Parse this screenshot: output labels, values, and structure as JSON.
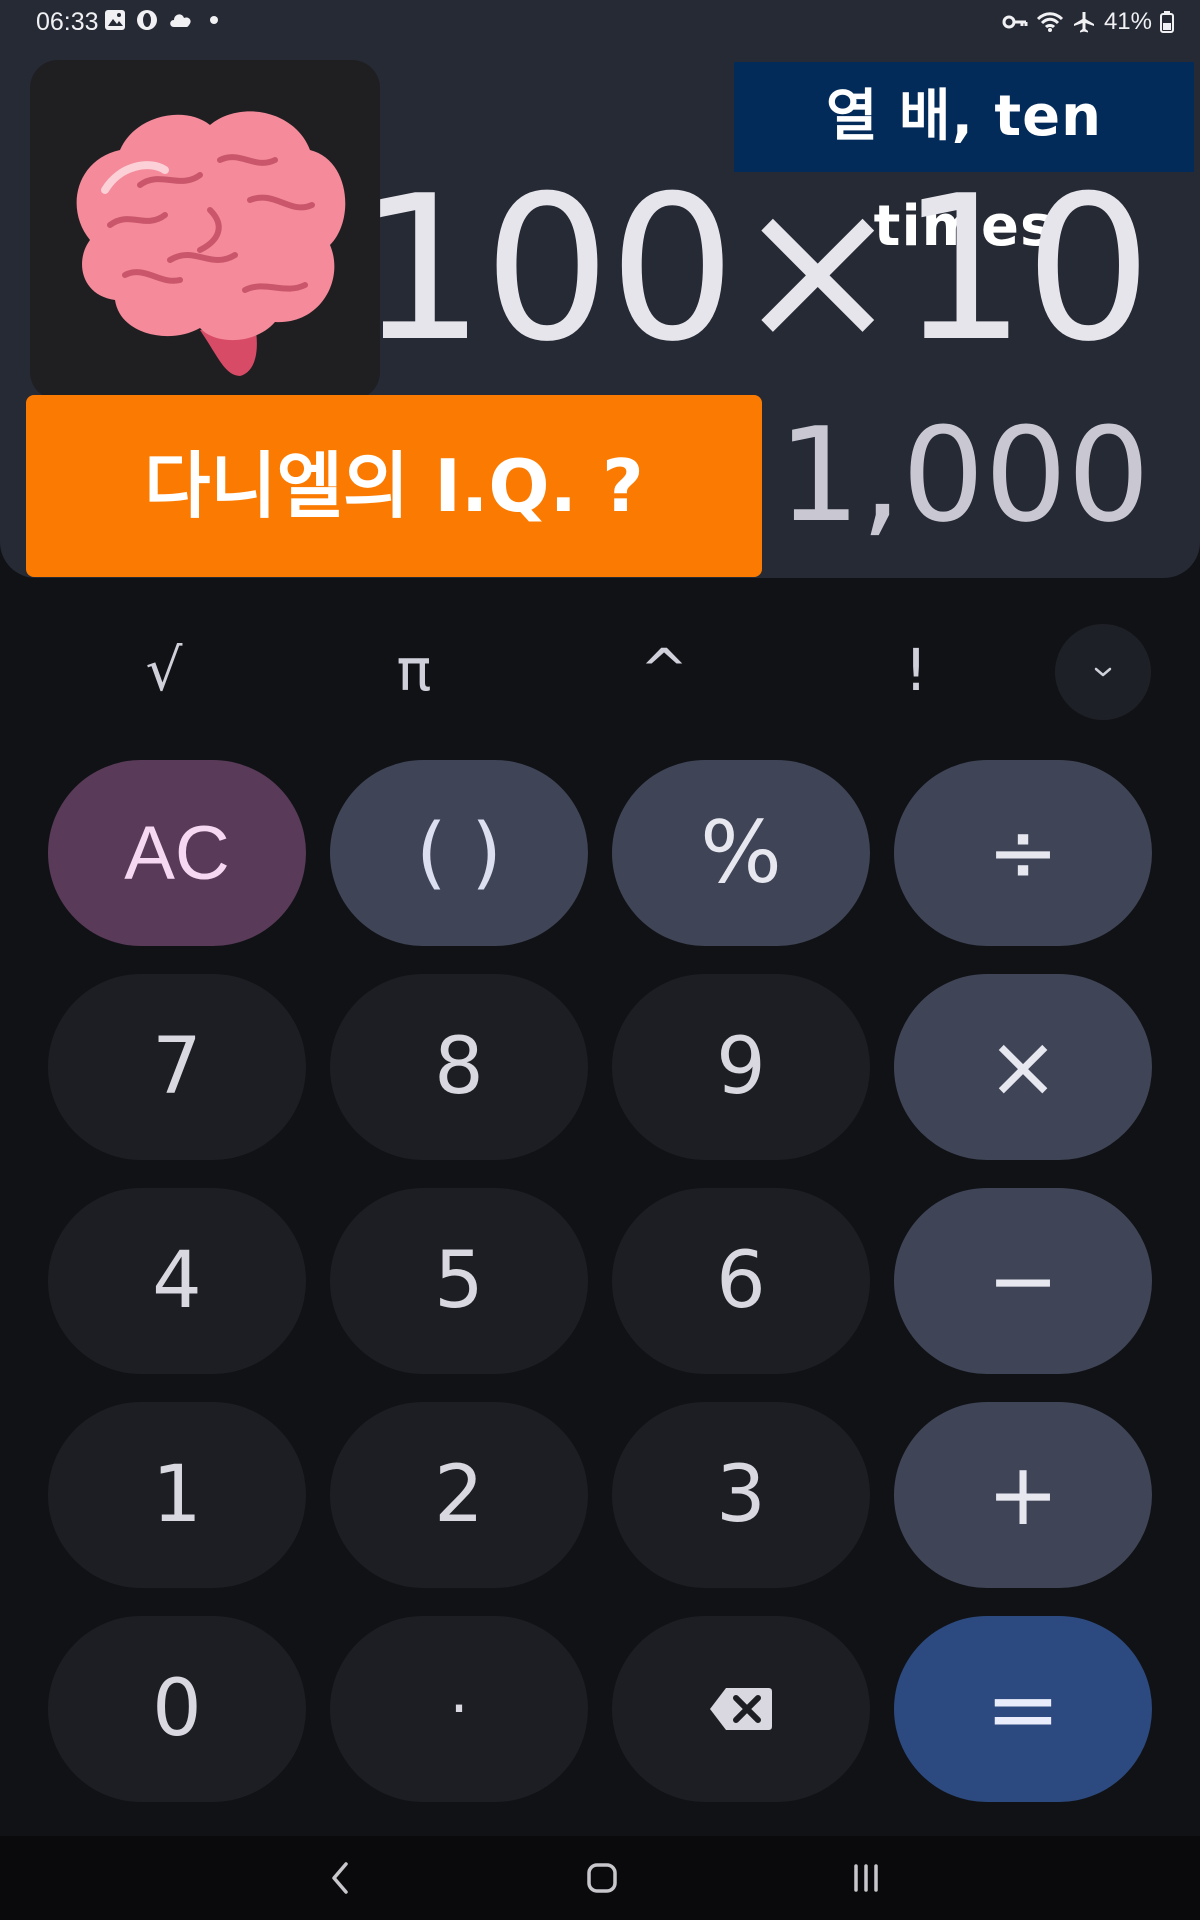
{
  "status_bar": {
    "time": "06:33",
    "battery": "41%"
  },
  "display": {
    "caption_en": "열 배, ten times",
    "expression": "100×10",
    "result": "1,000",
    "caption_ko": "다니엘의 I.Q. ?"
  },
  "scientific_keys": [
    "√",
    "π",
    "^",
    "!"
  ],
  "keypad": {
    "ac": "AC",
    "parentheses": "( )",
    "percent": "%",
    "divide": "÷",
    "seven": "7",
    "eight": "8",
    "nine": "9",
    "multiply": "×",
    "four": "4",
    "five": "5",
    "six": "6",
    "minus": "−",
    "one": "1",
    "two": "2",
    "three": "3",
    "plus": "+",
    "zero": "0",
    "decimal": "·",
    "equals": "="
  },
  "colors": {
    "display_bg": "#262a35",
    "keypad_bg": "#111216",
    "operator_key": "#3f4557",
    "ac_key": "#593a58",
    "equals_key": "#2c4a7f",
    "caption_ko_bg": "#fb7b02",
    "caption_en_bg": "#032b5a"
  },
  "icons": {
    "status_left": [
      "gallery-icon",
      "opera-icon",
      "cloud-icon",
      "notification-dot-icon"
    ],
    "status_right": [
      "key-icon",
      "wifi-icon",
      "airplane-icon",
      "battery-icon"
    ],
    "brain": "brain-emoji-icon",
    "expand": "chevron-down-icon",
    "backspace": "backspace-icon",
    "nav": [
      "back-icon",
      "home-icon",
      "recents-icon"
    ]
  }
}
